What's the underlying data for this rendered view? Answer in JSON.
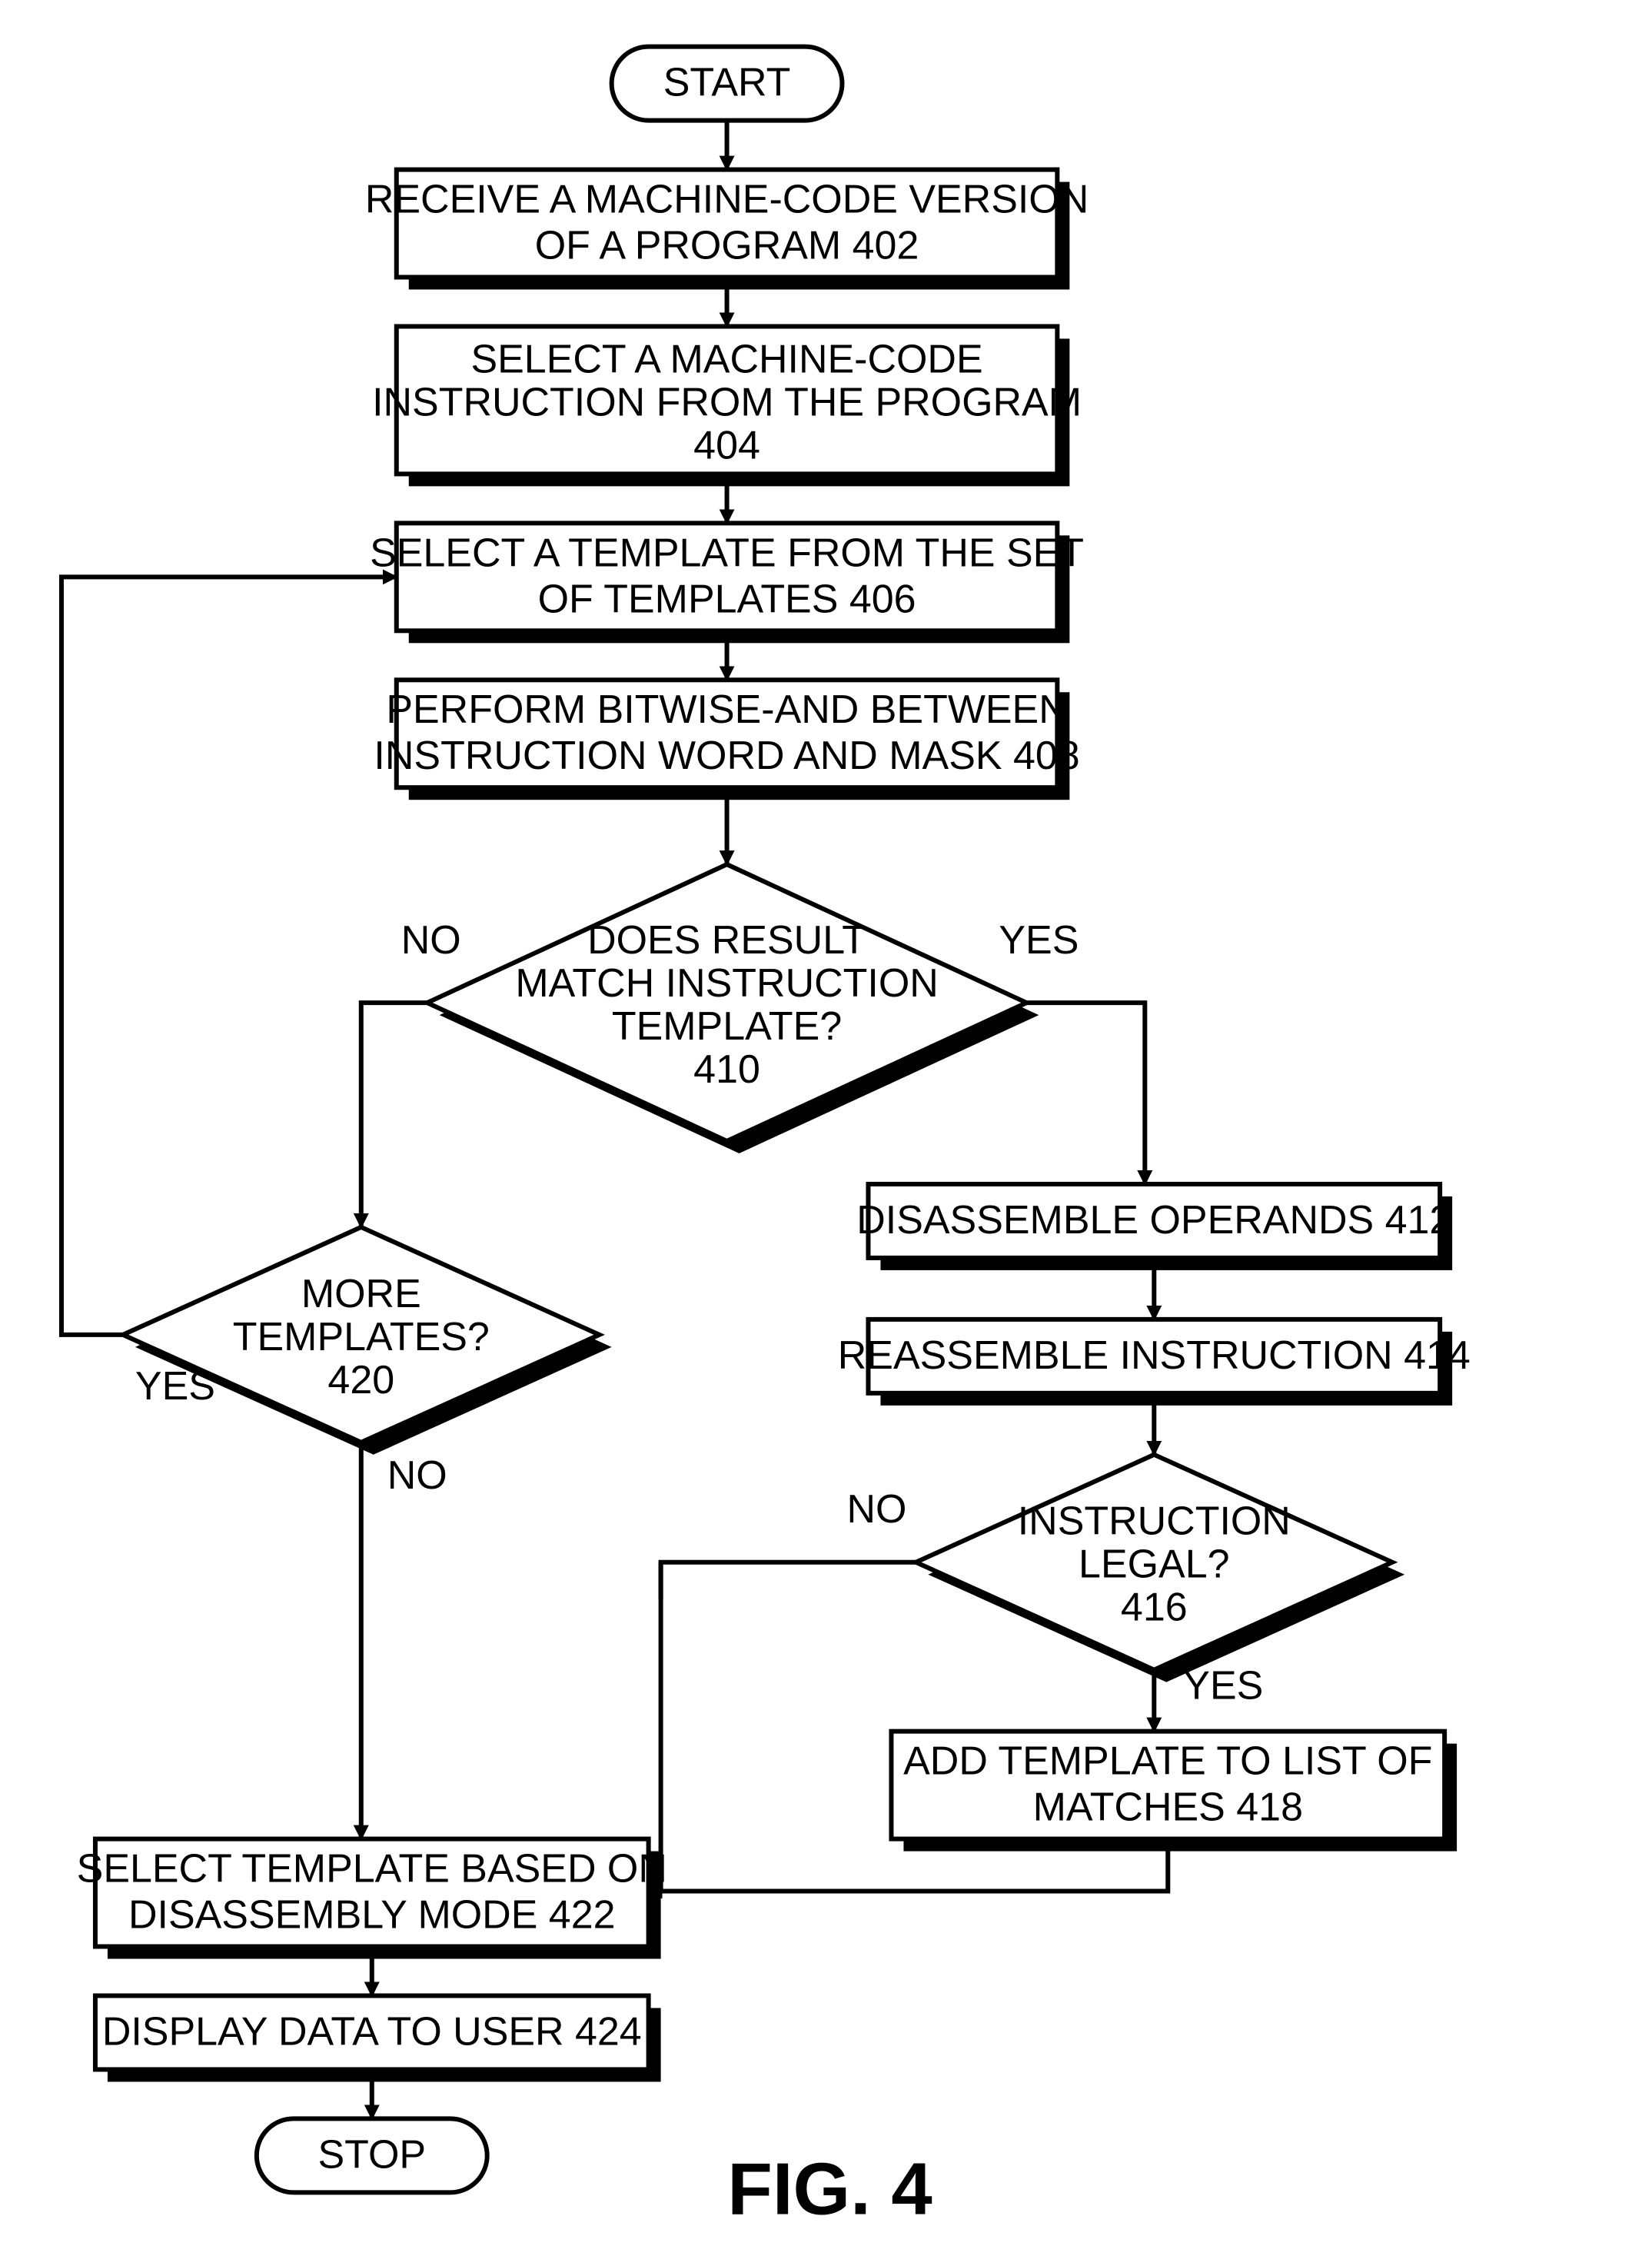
{
  "figure_label": "FIG. 4",
  "nodes": {
    "start": {
      "label": "START"
    },
    "n402": {
      "line1": "RECEIVE A MACHINE-CODE VERSION",
      "line2": "OF A PROGRAM 402"
    },
    "n404": {
      "line1": "SELECT A MACHINE-CODE",
      "line2": "INSTRUCTION FROM THE PROGRAM",
      "line3": "404"
    },
    "n406": {
      "line1": "SELECT A TEMPLATE FROM THE SET",
      "line2": "OF TEMPLATES 406"
    },
    "n408": {
      "line1": "PERFORM BITWISE-AND BETWEEN",
      "line2": "INSTRUCTION WORD AND MASK 408"
    },
    "d410": {
      "line1": "DOES RESULT",
      "line2": "MATCH INSTRUCTION",
      "line3": "TEMPLATE?",
      "line4": "410"
    },
    "n412": {
      "line1": "DISASSEMBLE OPERANDS 412"
    },
    "n414": {
      "line1": "REASSEMBLE INSTRUCTION 414"
    },
    "d416": {
      "line1": "INSTRUCTION",
      "line2": "LEGAL?",
      "line3": "416"
    },
    "n418": {
      "line1": "ADD TEMPLATE TO LIST OF",
      "line2": "MATCHES 418"
    },
    "d420": {
      "line1": "MORE",
      "line2": "TEMPLATES?",
      "line3": "420"
    },
    "n422": {
      "line1": "SELECT TEMPLATE BASED ON",
      "line2": "DISASSEMBLY MODE 422"
    },
    "n424": {
      "line1": "DISPLAY DATA TO USER 424"
    },
    "stop": {
      "label": "STOP"
    }
  },
  "edge_labels": {
    "d410_no": "NO",
    "d410_yes": "YES",
    "d416_no": "NO",
    "d416_yes": "YES",
    "d420_yes": "YES",
    "d420_no": "NO"
  }
}
